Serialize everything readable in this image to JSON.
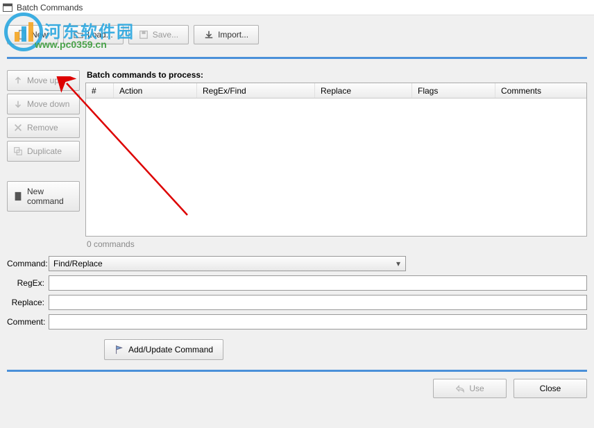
{
  "window": {
    "title": "Batch Commands"
  },
  "toolbar": {
    "new": "New",
    "load": "Load...",
    "save": "Save...",
    "import": "Import..."
  },
  "side": {
    "move_up": "Move up",
    "move_down": "Move down",
    "remove": "Remove",
    "duplicate": "Duplicate",
    "new_cmd": "New command"
  },
  "table": {
    "heading": "Batch commands to process:",
    "cols": {
      "num": "#",
      "action": "Action",
      "regex": "RegEx/Find",
      "replace": "Replace",
      "flags": "Flags",
      "comments": "Comments"
    },
    "count": "0 commands"
  },
  "form": {
    "command_label": "Command:",
    "command_value": "Find/Replace",
    "regex_label": "RegEx:",
    "regex_value": "",
    "replace_label": "Replace:",
    "replace_value": "",
    "comment_label": "Comment:",
    "comment_value": "",
    "add_update": "Add/Update Command"
  },
  "dialog": {
    "use": "Use",
    "close": "Close"
  },
  "watermark": {
    "cn": "河东软件园",
    "url": "www.pc0359.cn"
  }
}
